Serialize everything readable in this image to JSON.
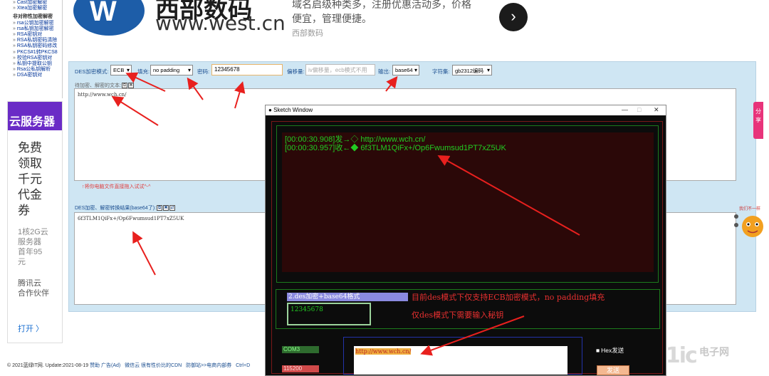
{
  "leftnav": {
    "items_top": [
      "Cast加密解密",
      "Xtea加密解密"
    ],
    "section": "非对称性加密解密",
    "items": [
      "rsa公钥加密解密",
      "rsa私钥加密解密",
      "RSA密钥对",
      "RSA私钥密码清除",
      "RSA私钥密码修改",
      "PKCS#1转PKCS8",
      "校验RSA密钥对",
      "私钥中提取公钥",
      "Rsa公私钥解析",
      "DSA密钥对"
    ]
  },
  "left_ad": {
    "top": "云服务器",
    "lines": [
      "免费",
      "领取",
      "千元",
      "代金",
      "券"
    ],
    "sub": [
      "1核2G云",
      "服务器",
      "首年95",
      "元"
    ],
    "brand": [
      "腾讯云",
      "合作伙伴"
    ],
    "open": "打开 〉"
  },
  "top_ad": {
    "logo_letter": "W",
    "brand_big": "西部数码",
    "brand_url": "www.west.cn",
    "text": "域名启级种类多，注册优惠活动多，价格便宜，管理便捷。",
    "sub": "西部数码",
    "button": "›"
  },
  "toolbar": {
    "mode_label": "DES加密模式:",
    "mode_value": "ECB",
    "padding_label": "填充:",
    "padding_value": "no padding",
    "key_label": "密码:",
    "key_value": "12345678",
    "iv_label": "偏移量:",
    "iv_placeholder": "iv偏移量，ecb模式不用",
    "output_label": "输出:",
    "output_value": "base64",
    "charset_label": "字符集:",
    "charset_value": "gb2312编码"
  },
  "input_area": {
    "label": "待加密、解密的文本:",
    "value": "http://www.wch.cn/",
    "hint": "↑将你电脑文件直接拖入试试^-^"
  },
  "output_area": {
    "label": "DES加密、解密转换结果(base64了):",
    "value": "6f3TLM1QiFx+/Op6Fwumsud1PT7xZ5UK"
  },
  "sketch": {
    "title": "Sketch Window",
    "log": [
      "[00:00:30.908]发→◇ http://www.wch.cn/",
      "[00:00:30.957]收←◆ 6f3TLM1QiFx+/Op6Fwumsud1PT7xZ5UK"
    ],
    "mode_select": "2.des加密+base64格式",
    "key_value": "12345678",
    "note1": "目前des模式下仅支持ECB加密模式，no padding填充",
    "note2": "仅des模式下需要输入秘钥",
    "com_port": "COM3",
    "baud": "115200",
    "send_text": "http://www.wch.cn/",
    "hex_label": "Hex发送",
    "send_button": "发送"
  },
  "share": "分享",
  "mascot_caption": "我们不一样",
  "footer": {
    "copyright": "© 2021蓝绿IT网. Update:2021-08-19",
    "links": [
      "赞助",
      "广告(Ad)",
      "微信云",
      "很有性价比的CDN",
      "防御站>>电商内部券",
      "Ctrl+D"
    ]
  },
  "watermark": "21ic",
  "watermark2": "电子网"
}
